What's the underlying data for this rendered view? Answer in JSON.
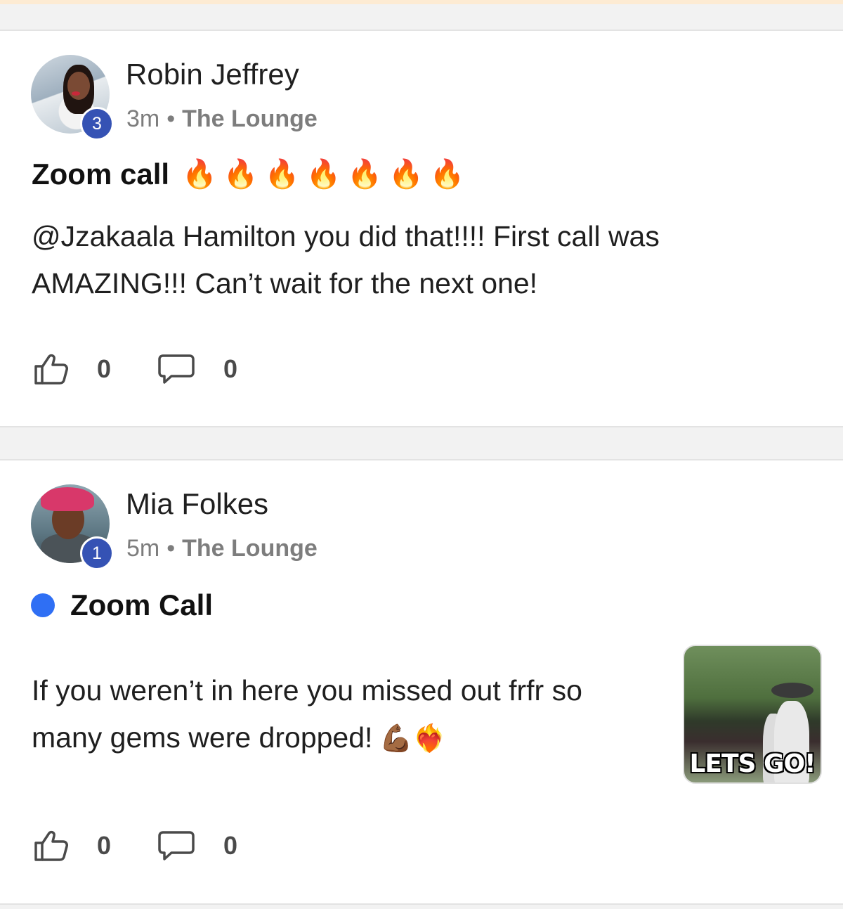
{
  "posts": [
    {
      "author": "Robin Jeffrey",
      "badge": "3",
      "time": "3m",
      "separator": "•",
      "group": "The Lounge",
      "title": "Zoom call",
      "title_emoji": [
        "🔥",
        "🔥",
        "🔥",
        "🔥",
        "🔥",
        "🔥",
        "🔥"
      ],
      "body": "@Jzakaala Hamilton you did that!!!! First call was AMAZING!!! Can’t wait for the next one!",
      "likes": "0",
      "comments": "0"
    },
    {
      "author": "Mia Folkes",
      "badge": "1",
      "time": "5m",
      "separator": "•",
      "group": "The Lounge",
      "title": "Zoom Call",
      "unread": true,
      "body": "If you weren’t in here you missed out frfr so many gems were dropped!",
      "body_emoji": "💪🏾❤️‍🔥",
      "thumbnail_caption": "LETS GO!",
      "likes": "0",
      "comments": "0"
    }
  ],
  "colors": {
    "badge": "#3552b4",
    "unread_dot": "#2f6ff4",
    "meta_text": "#7d7d7d",
    "divider": "#e3e3e3"
  },
  "icons": {
    "like": "thumbs-up-icon",
    "comment": "speech-bubble-icon"
  }
}
